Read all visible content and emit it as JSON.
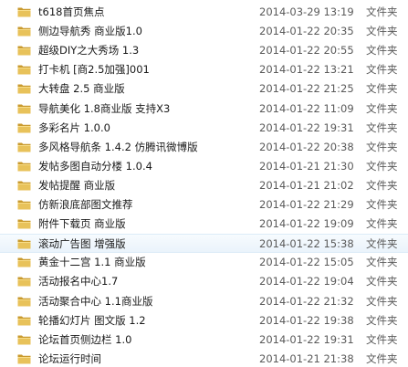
{
  "folder_color": "#e8c25a",
  "folder_shade": "#c99a2e",
  "files": [
    {
      "name": "t618首页焦点",
      "date": "2014-03-29 13:19",
      "type": "文件夹"
    },
    {
      "name": "侧边导航秀 商业版1.0",
      "date": "2014-01-22 20:35",
      "type": "文件夹"
    },
    {
      "name": "超级DIY之大秀场 1.3",
      "date": "2014-01-22 20:55",
      "type": "文件夹"
    },
    {
      "name": "打卡机 [商2.5加强]001",
      "date": "2014-01-22 13:21",
      "type": "文件夹"
    },
    {
      "name": "大转盘 2.5 商业版",
      "date": "2014-01-22 21:25",
      "type": "文件夹"
    },
    {
      "name": "导航美化 1.8商业版 支持X3",
      "date": "2014-01-22 11:09",
      "type": "文件夹"
    },
    {
      "name": "多彩名片 1.0.0",
      "date": "2014-01-22 19:31",
      "type": "文件夹"
    },
    {
      "name": "多风格导航条 1.4.2 仿腾讯微博版",
      "date": "2014-01-22 20:38",
      "type": "文件夹"
    },
    {
      "name": "发帖多图自动分楼 1.0.4",
      "date": "2014-01-21 21:30",
      "type": "文件夹"
    },
    {
      "name": "发帖提醒 商业版",
      "date": "2014-01-21 21:02",
      "type": "文件夹"
    },
    {
      "name": "仿新浪底部图文推荐",
      "date": "2014-01-22 21:29",
      "type": "文件夹"
    },
    {
      "name": "附件下载页 商业版",
      "date": "2014-01-22 19:09",
      "type": "文件夹"
    },
    {
      "name": "滚动广告图 增强版",
      "date": "2014-01-22 15:38",
      "type": "文件夹",
      "selected": true
    },
    {
      "name": "黄金十二宫 1.1 商业版",
      "date": "2014-01-22 15:05",
      "type": "文件夹"
    },
    {
      "name": "活动报名中心1.7",
      "date": "2014-01-22 19:04",
      "type": "文件夹"
    },
    {
      "name": "活动聚合中心 1.1商业版",
      "date": "2014-01-22 21:32",
      "type": "文件夹"
    },
    {
      "name": "轮播幻灯片 图文版 1.2",
      "date": "2014-01-22 19:38",
      "type": "文件夹"
    },
    {
      "name": "论坛首页侧边栏 1.0",
      "date": "2014-01-22 19:31",
      "type": "文件夹"
    },
    {
      "name": "论坛运行时间",
      "date": "2014-01-21 21:38",
      "type": "文件夹"
    }
  ]
}
